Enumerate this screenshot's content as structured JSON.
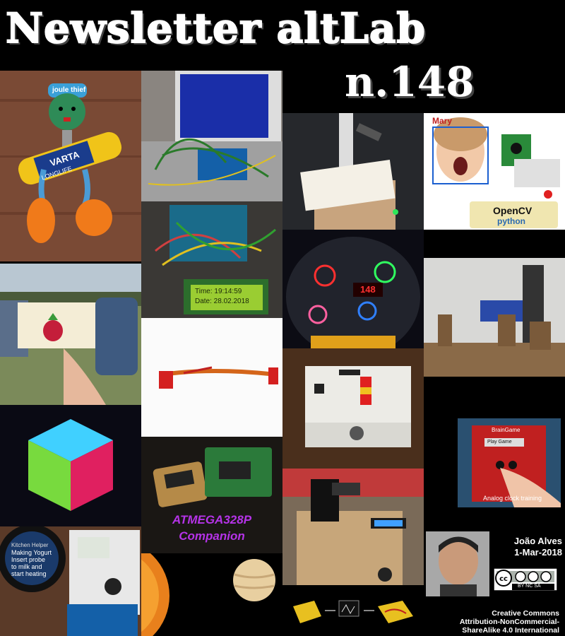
{
  "header": {
    "title": "Newsletter altLab",
    "issue": "n.148"
  },
  "tiles": {
    "joule_thief_label": "joule thief",
    "battery_brand": "VARTA",
    "battery_sub": "LONGLIFE",
    "lcd_line1": "Time: 19:14:59",
    "lcd_line2": "Date: 28.02.2018",
    "mary_label": "Mary",
    "opencv_label": "OpenCV",
    "python_label": "python",
    "nixie_number": "148",
    "atmega_line1": "ATMEGA328P",
    "atmega_line2": "Companion",
    "braingame_title": "BrainGame",
    "braingame_button": "Play Game",
    "analog_label": "Analog clock training",
    "yogurt_title": "Kitchen Helper",
    "yogurt_text": "Making Yogurt Insert probe to milk and start heating"
  },
  "author": {
    "name": "João Alves",
    "date": "1-Mar-2018"
  },
  "license": {
    "badge": "BY NC SA",
    "line1": "Creative Commons",
    "line2": "Attribution-NonCommercial-",
    "line3": "ShareAlike 4.0 International"
  },
  "colors": {
    "background": "#000000",
    "atmega_text": "#b533e8",
    "lcd_green": "#9acd32"
  }
}
